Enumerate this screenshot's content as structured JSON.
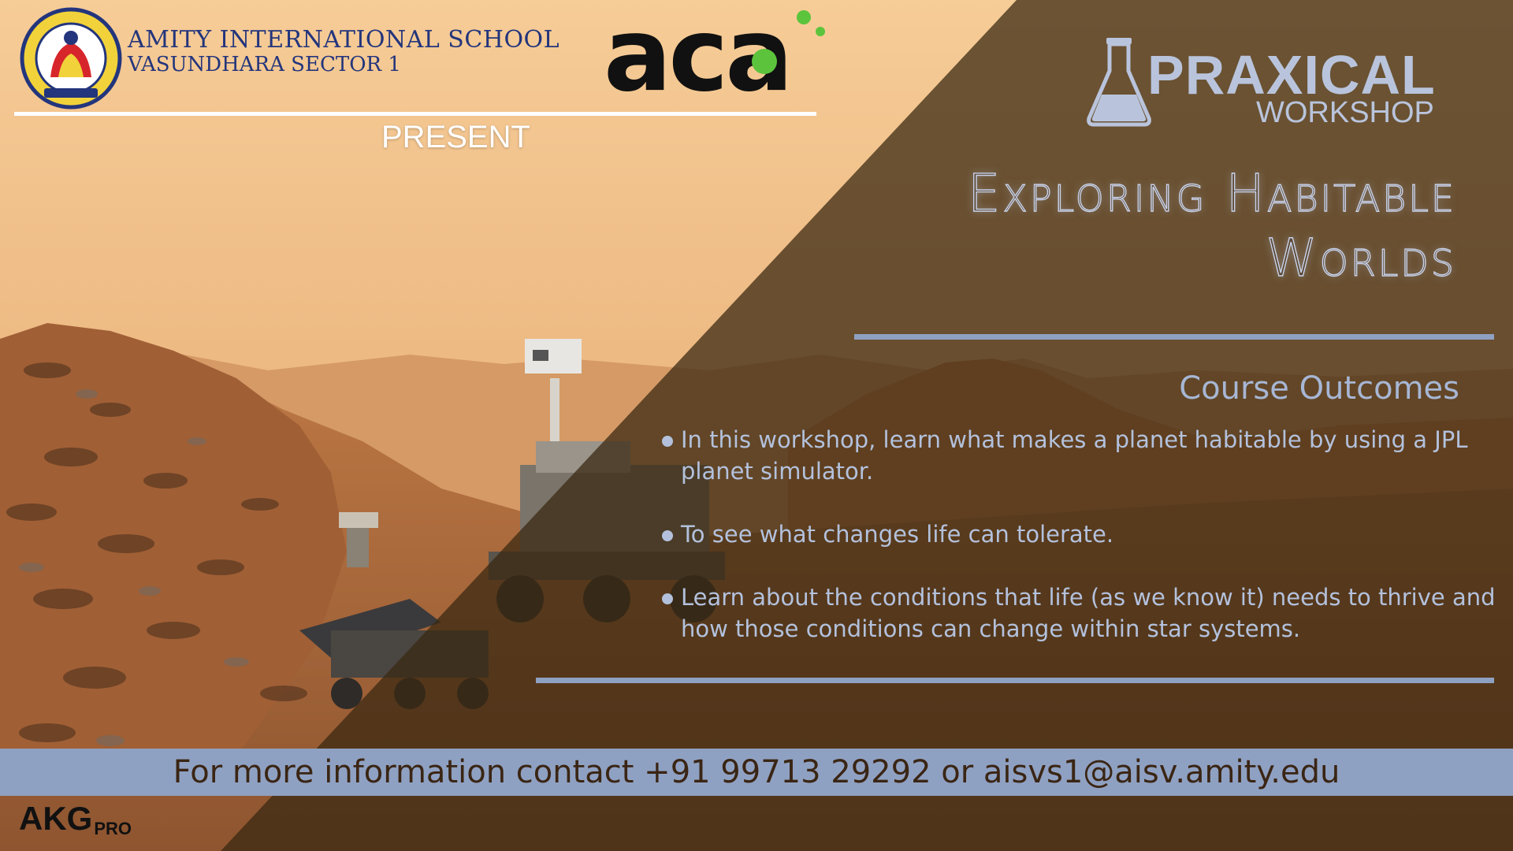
{
  "header": {
    "school_line1": "AMITY INTERNATIONAL SCHOOL",
    "school_line2": "VASUNDHARA SECTOR 1",
    "school_logo_text": "AMITY INTERNATIONAL SCHOOL",
    "aca_logo_text": "aca",
    "present": "PRESENT"
  },
  "brand": {
    "praxical": "PRAXICAL",
    "workshop": "WORKSHOP"
  },
  "title": {
    "line1": "Exploring Habitable",
    "line2": "Worlds"
  },
  "outcomes": {
    "heading": "Course Outcomes",
    "items": [
      "In this workshop, learn what makes a planet habitable by using a JPL planet simulator.",
      "To see what changes life can tolerate.",
      "Learn about the conditions that life (as we know it) needs to thrive and how those conditions can change within star systems."
    ]
  },
  "contact": {
    "text": "For more information contact +91 99713 29292 or aisvs1@aisv.amity.edu"
  },
  "footer": {
    "brand": "AKG",
    "brand_suffix": "PRO"
  },
  "colors": {
    "sky": "#f3c48e",
    "mars_ground": "#b06a3a",
    "dark_overlay": "#3c2a16",
    "accent_blue": "#8fa1c2",
    "text_blue": "#b3c1dc",
    "school_blue": "#23357c",
    "aca_green": "#5cc43c"
  },
  "icons": [
    "school-emblem-icon",
    "aca-logo",
    "flask-icon",
    "mars-rover-image"
  ]
}
